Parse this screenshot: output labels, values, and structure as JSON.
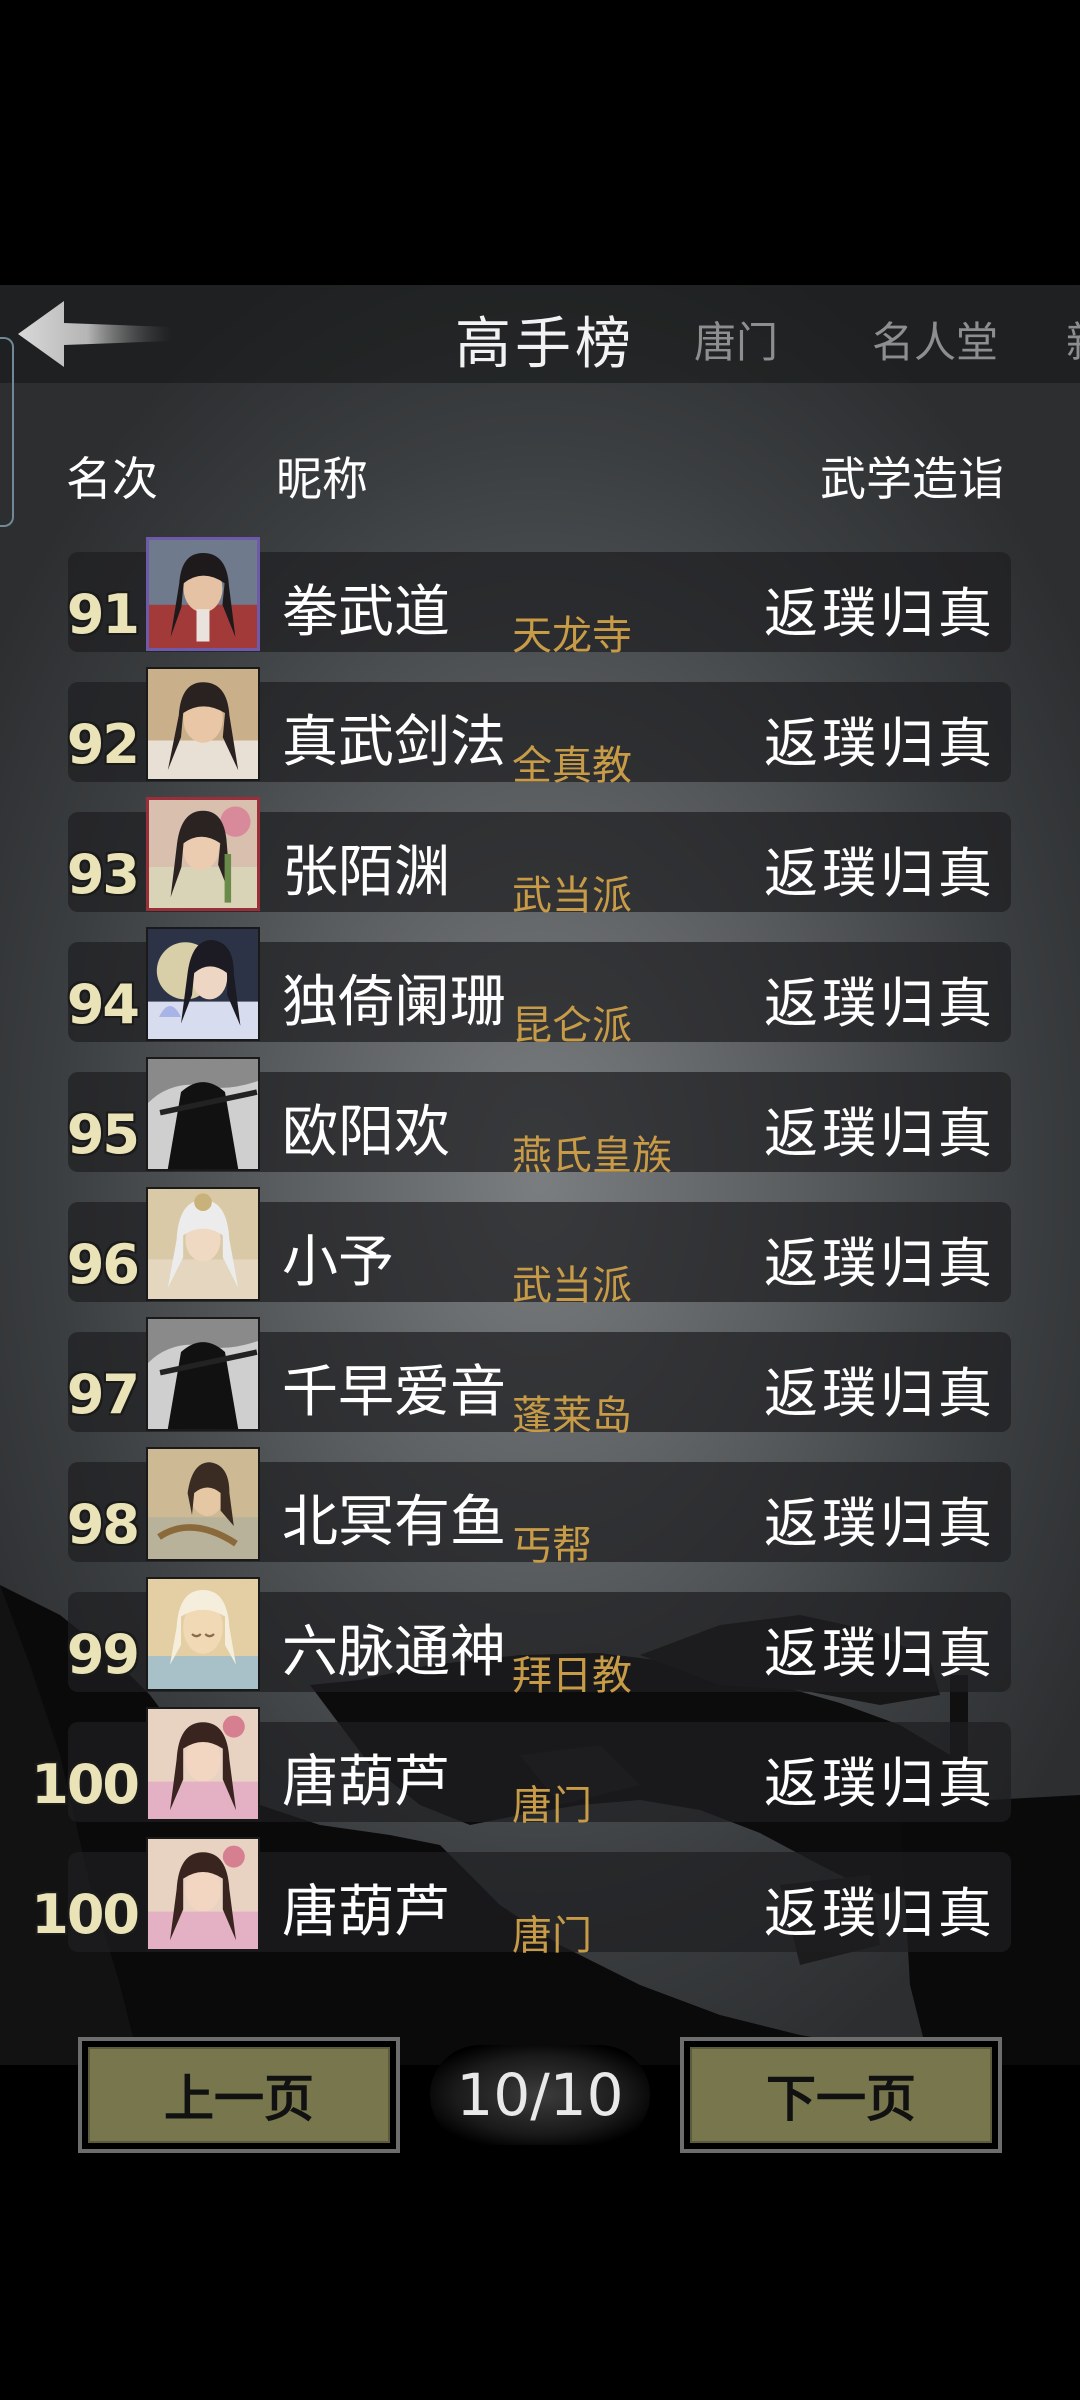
{
  "header": {
    "back_icon": "back-arrow-icon",
    "tabs": [
      {
        "label": "高手榜",
        "active": true
      },
      {
        "label": "唐门",
        "active": false
      },
      {
        "label": "名人堂",
        "active": false
      },
      {
        "label": "新",
        "active": false
      }
    ]
  },
  "columns": {
    "rank": "名次",
    "nickname": "昵称",
    "skill": "武学造诣"
  },
  "rows": [
    {
      "rank": "91",
      "name": "拳武道",
      "sect": "天龙寺",
      "skill": "返璞归真"
    },
    {
      "rank": "92",
      "name": "真武剑法",
      "sect": "全真教",
      "skill": "返璞归真"
    },
    {
      "rank": "93",
      "name": "张陌渊",
      "sect": "武当派",
      "skill": "返璞归真"
    },
    {
      "rank": "94",
      "name": "独倚阑珊",
      "sect": "昆仑派",
      "skill": "返璞归真"
    },
    {
      "rank": "95",
      "name": "欧阳欢",
      "sect": "燕氏皇族",
      "skill": "返璞归真"
    },
    {
      "rank": "96",
      "name": "小予",
      "sect": "武当派",
      "skill": "返璞归真"
    },
    {
      "rank": "97",
      "name": "千早爱音",
      "sect": "蓬莱岛",
      "skill": "返璞归真"
    },
    {
      "rank": "98",
      "name": "北冥有鱼",
      "sect": "丐帮",
      "skill": "返璞归真"
    },
    {
      "rank": "99",
      "name": "六脉通神",
      "sect": "拜日教",
      "skill": "返璞归真"
    },
    {
      "rank": "100",
      "name": "唐葫芦",
      "sect": "唐门",
      "skill": "返璞归真"
    },
    {
      "rank": "100",
      "name": "唐葫芦",
      "sect": "唐门",
      "skill": "返璞归真"
    }
  ],
  "pager": {
    "prev_label": "上一页",
    "next_label": "下一页",
    "page": "10/10"
  },
  "colors": {
    "rank": "#ebe3b8",
    "sect": "#c89b47",
    "button": "#77764d"
  }
}
